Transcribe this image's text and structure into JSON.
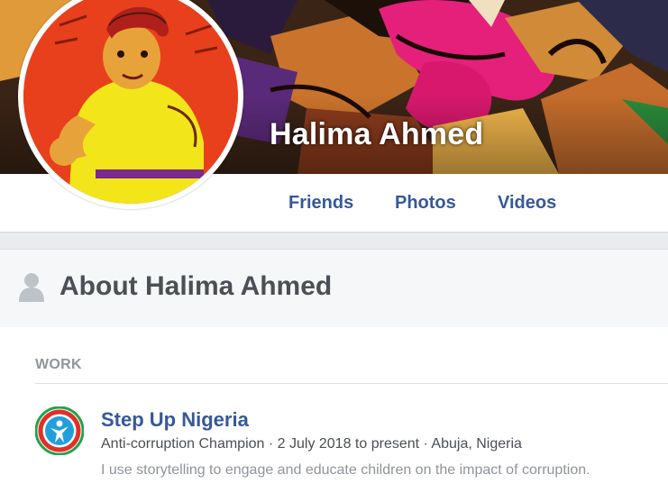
{
  "profile": {
    "name": "Halima Ahmed"
  },
  "nav": {
    "tabs": [
      {
        "label": "Friends"
      },
      {
        "label": "Photos"
      },
      {
        "label": "Videos"
      }
    ]
  },
  "about": {
    "title": "About Halima Ahmed",
    "icon": "person-silhouette-icon"
  },
  "work": {
    "section_label": "WORK",
    "entries": [
      {
        "organization": "Step Up Nigeria",
        "logo_icon": "step-up-nigeria-logo",
        "details": "Anti-corruption Champion · 2 July 2018 to present · Abuja, Nigeria",
        "description": "I use storytelling to engage and educate children on the impact of corruption."
      }
    ]
  },
  "colors": {
    "link": "#365899",
    "heading": "#4b4f56",
    "muted": "#90949c",
    "page_bg": "#e9ebee"
  }
}
